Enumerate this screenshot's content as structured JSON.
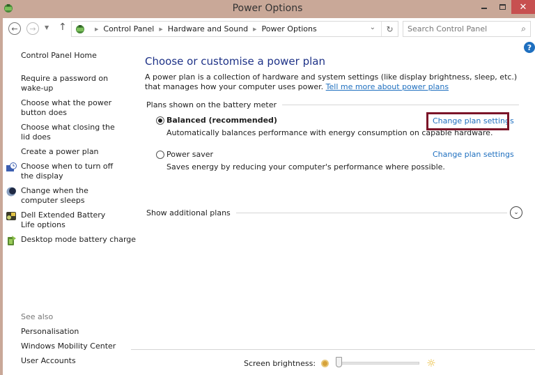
{
  "window": {
    "title": "Power Options",
    "minimize_glyph": "",
    "close_glyph": "✕"
  },
  "nav": {
    "back_glyph": "←",
    "forward_glyph": "→",
    "recent_glyph": "▼",
    "up_glyph": "↑",
    "breadcrumbs": [
      "Control Panel",
      "Hardware and Sound",
      "Power Options"
    ],
    "separator_glyph": "▶",
    "dropdown_glyph": "⌄",
    "refresh_glyph": "↻",
    "search_placeholder": "Search Control Panel",
    "search_value": "",
    "search_glyph": "⌕"
  },
  "help": {
    "glyph": "?"
  },
  "sidebar": {
    "home": "Control Panel Home",
    "tasks": [
      {
        "label": "Require a password on wake-up",
        "icon": "none"
      },
      {
        "label": "Choose what the power button does",
        "icon": "none"
      },
      {
        "label": "Choose what closing the lid does",
        "icon": "none"
      },
      {
        "label": "Create a power plan",
        "icon": "none"
      },
      {
        "label": "Choose when to turn off the display",
        "icon": "display-clock-icon"
      },
      {
        "label": "Change when the computer sleeps",
        "icon": "moon-sleep-icon"
      },
      {
        "label": "Dell Extended Battery Life options",
        "icon": "dell-battery-icon"
      },
      {
        "label": "Desktop mode battery charge",
        "icon": "battery-charge-icon"
      }
    ],
    "see_also_heading": "See also",
    "see_also": [
      "Personalisation",
      "Windows Mobility Center",
      "User Accounts"
    ]
  },
  "main": {
    "title": "Choose or customise a power plan",
    "description": "A power plan is a collection of hardware and system settings (like display brightness, sleep, etc.) that manages how your computer uses power. ",
    "learn_more_link": "Tell me more about power plans",
    "group_label": "Plans shown on the battery meter",
    "plans": [
      {
        "name": "Balanced (recommended)",
        "description": "Automatically balances performance with energy consumption on capable hardware.",
        "selected": true,
        "change_link": "Change plan settings"
      },
      {
        "name": "Power saver",
        "description": "Saves energy by reducing your computer's performance where possible.",
        "selected": false,
        "change_link": "Change plan settings"
      }
    ],
    "show_additional": "Show additional plans",
    "expand_glyph": "⌄"
  },
  "footer": {
    "brightness_label": "Screen brightness:",
    "brightness_fraction": 0.0,
    "sun_glyph": "☼"
  },
  "colors": {
    "title_bar": "#c9a898",
    "close_button": "#c75050",
    "link": "#1e6fbf",
    "heading": "#1e3287",
    "highlight_box": "#7b1428"
  }
}
